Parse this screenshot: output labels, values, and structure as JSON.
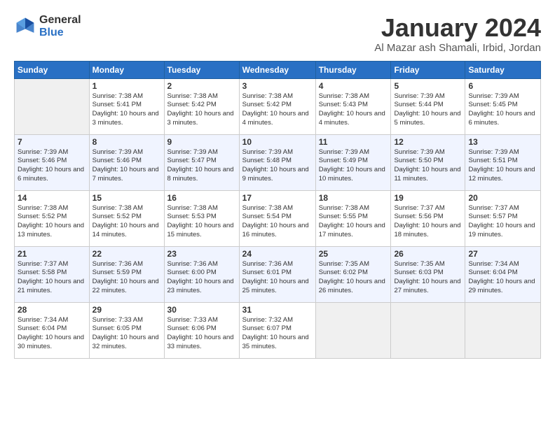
{
  "logo": {
    "general": "General",
    "blue": "Blue"
  },
  "title": "January 2024",
  "subtitle": "Al Mazar ash Shamali, Irbid, Jordan",
  "days": [
    "Sunday",
    "Monday",
    "Tuesday",
    "Wednesday",
    "Thursday",
    "Friday",
    "Saturday"
  ],
  "weeks": [
    [
      {
        "num": "",
        "sunrise": "",
        "sunset": "",
        "daylight": ""
      },
      {
        "num": "1",
        "sunrise": "Sunrise: 7:38 AM",
        "sunset": "Sunset: 5:41 PM",
        "daylight": "Daylight: 10 hours and 3 minutes."
      },
      {
        "num": "2",
        "sunrise": "Sunrise: 7:38 AM",
        "sunset": "Sunset: 5:42 PM",
        "daylight": "Daylight: 10 hours and 3 minutes."
      },
      {
        "num": "3",
        "sunrise": "Sunrise: 7:38 AM",
        "sunset": "Sunset: 5:42 PM",
        "daylight": "Daylight: 10 hours and 4 minutes."
      },
      {
        "num": "4",
        "sunrise": "Sunrise: 7:38 AM",
        "sunset": "Sunset: 5:43 PM",
        "daylight": "Daylight: 10 hours and 4 minutes."
      },
      {
        "num": "5",
        "sunrise": "Sunrise: 7:39 AM",
        "sunset": "Sunset: 5:44 PM",
        "daylight": "Daylight: 10 hours and 5 minutes."
      },
      {
        "num": "6",
        "sunrise": "Sunrise: 7:39 AM",
        "sunset": "Sunset: 5:45 PM",
        "daylight": "Daylight: 10 hours and 6 minutes."
      }
    ],
    [
      {
        "num": "7",
        "sunrise": "Sunrise: 7:39 AM",
        "sunset": "Sunset: 5:46 PM",
        "daylight": "Daylight: 10 hours and 6 minutes."
      },
      {
        "num": "8",
        "sunrise": "Sunrise: 7:39 AM",
        "sunset": "Sunset: 5:46 PM",
        "daylight": "Daylight: 10 hours and 7 minutes."
      },
      {
        "num": "9",
        "sunrise": "Sunrise: 7:39 AM",
        "sunset": "Sunset: 5:47 PM",
        "daylight": "Daylight: 10 hours and 8 minutes."
      },
      {
        "num": "10",
        "sunrise": "Sunrise: 7:39 AM",
        "sunset": "Sunset: 5:48 PM",
        "daylight": "Daylight: 10 hours and 9 minutes."
      },
      {
        "num": "11",
        "sunrise": "Sunrise: 7:39 AM",
        "sunset": "Sunset: 5:49 PM",
        "daylight": "Daylight: 10 hours and 10 minutes."
      },
      {
        "num": "12",
        "sunrise": "Sunrise: 7:39 AM",
        "sunset": "Sunset: 5:50 PM",
        "daylight": "Daylight: 10 hours and 11 minutes."
      },
      {
        "num": "13",
        "sunrise": "Sunrise: 7:39 AM",
        "sunset": "Sunset: 5:51 PM",
        "daylight": "Daylight: 10 hours and 12 minutes."
      }
    ],
    [
      {
        "num": "14",
        "sunrise": "Sunrise: 7:38 AM",
        "sunset": "Sunset: 5:52 PM",
        "daylight": "Daylight: 10 hours and 13 minutes."
      },
      {
        "num": "15",
        "sunrise": "Sunrise: 7:38 AM",
        "sunset": "Sunset: 5:52 PM",
        "daylight": "Daylight: 10 hours and 14 minutes."
      },
      {
        "num": "16",
        "sunrise": "Sunrise: 7:38 AM",
        "sunset": "Sunset: 5:53 PM",
        "daylight": "Daylight: 10 hours and 15 minutes."
      },
      {
        "num": "17",
        "sunrise": "Sunrise: 7:38 AM",
        "sunset": "Sunset: 5:54 PM",
        "daylight": "Daylight: 10 hours and 16 minutes."
      },
      {
        "num": "18",
        "sunrise": "Sunrise: 7:38 AM",
        "sunset": "Sunset: 5:55 PM",
        "daylight": "Daylight: 10 hours and 17 minutes."
      },
      {
        "num": "19",
        "sunrise": "Sunrise: 7:37 AM",
        "sunset": "Sunset: 5:56 PM",
        "daylight": "Daylight: 10 hours and 18 minutes."
      },
      {
        "num": "20",
        "sunrise": "Sunrise: 7:37 AM",
        "sunset": "Sunset: 5:57 PM",
        "daylight": "Daylight: 10 hours and 19 minutes."
      }
    ],
    [
      {
        "num": "21",
        "sunrise": "Sunrise: 7:37 AM",
        "sunset": "Sunset: 5:58 PM",
        "daylight": "Daylight: 10 hours and 21 minutes."
      },
      {
        "num": "22",
        "sunrise": "Sunrise: 7:36 AM",
        "sunset": "Sunset: 5:59 PM",
        "daylight": "Daylight: 10 hours and 22 minutes."
      },
      {
        "num": "23",
        "sunrise": "Sunrise: 7:36 AM",
        "sunset": "Sunset: 6:00 PM",
        "daylight": "Daylight: 10 hours and 23 minutes."
      },
      {
        "num": "24",
        "sunrise": "Sunrise: 7:36 AM",
        "sunset": "Sunset: 6:01 PM",
        "daylight": "Daylight: 10 hours and 25 minutes."
      },
      {
        "num": "25",
        "sunrise": "Sunrise: 7:35 AM",
        "sunset": "Sunset: 6:02 PM",
        "daylight": "Daylight: 10 hours and 26 minutes."
      },
      {
        "num": "26",
        "sunrise": "Sunrise: 7:35 AM",
        "sunset": "Sunset: 6:03 PM",
        "daylight": "Daylight: 10 hours and 27 minutes."
      },
      {
        "num": "27",
        "sunrise": "Sunrise: 7:34 AM",
        "sunset": "Sunset: 6:04 PM",
        "daylight": "Daylight: 10 hours and 29 minutes."
      }
    ],
    [
      {
        "num": "28",
        "sunrise": "Sunrise: 7:34 AM",
        "sunset": "Sunset: 6:04 PM",
        "daylight": "Daylight: 10 hours and 30 minutes."
      },
      {
        "num": "29",
        "sunrise": "Sunrise: 7:33 AM",
        "sunset": "Sunset: 6:05 PM",
        "daylight": "Daylight: 10 hours and 32 minutes."
      },
      {
        "num": "30",
        "sunrise": "Sunrise: 7:33 AM",
        "sunset": "Sunset: 6:06 PM",
        "daylight": "Daylight: 10 hours and 33 minutes."
      },
      {
        "num": "31",
        "sunrise": "Sunrise: 7:32 AM",
        "sunset": "Sunset: 6:07 PM",
        "daylight": "Daylight: 10 hours and 35 minutes."
      },
      {
        "num": "",
        "sunrise": "",
        "sunset": "",
        "daylight": ""
      },
      {
        "num": "",
        "sunrise": "",
        "sunset": "",
        "daylight": ""
      },
      {
        "num": "",
        "sunrise": "",
        "sunset": "",
        "daylight": ""
      }
    ]
  ]
}
